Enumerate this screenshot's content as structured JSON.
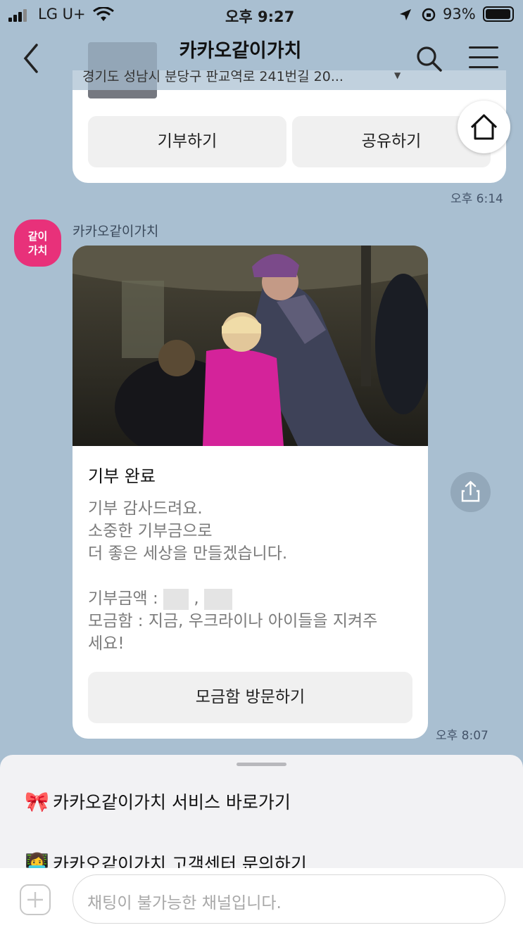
{
  "status_bar": {
    "carrier": "LG U+",
    "time": "오후 9:27",
    "battery": "93%"
  },
  "header": {
    "title": "카카오같이가치",
    "subtitle": "경기도 성남시 분당구 판교역로 241번길 20..."
  },
  "card1": {
    "donate_label": "기부하기",
    "share_label": "공유하기",
    "time": "오후 6:14"
  },
  "message": {
    "avatar_line1": "같이",
    "avatar_line2": "가치",
    "sender": "카카오같이가치",
    "card_title": "기부 완료",
    "lines": [
      "기부 감사드려요.",
      "소중한 기부금으로",
      "더 좋은 세상을 만들겠습니다.",
      "",
      "기부금액 :",
      "모금함 : 지금, 우크라이나 아이들을 지켜주",
      "세요!"
    ],
    "visit_label": "모금함 방문하기",
    "time": "오후 8:07"
  },
  "sheet": {
    "items": [
      {
        "emoji": "🎀",
        "label": "카카오같이가치 서비스 바로가기"
      },
      {
        "emoji": "👩‍💻",
        "label": "카카오같이가치 고객센터 문의하기"
      }
    ]
  },
  "input": {
    "placeholder": "채팅이 불가능한 채널입니다."
  },
  "colors": {
    "chat_bg": "#a9bfd1",
    "avatar": "#e8317a"
  }
}
